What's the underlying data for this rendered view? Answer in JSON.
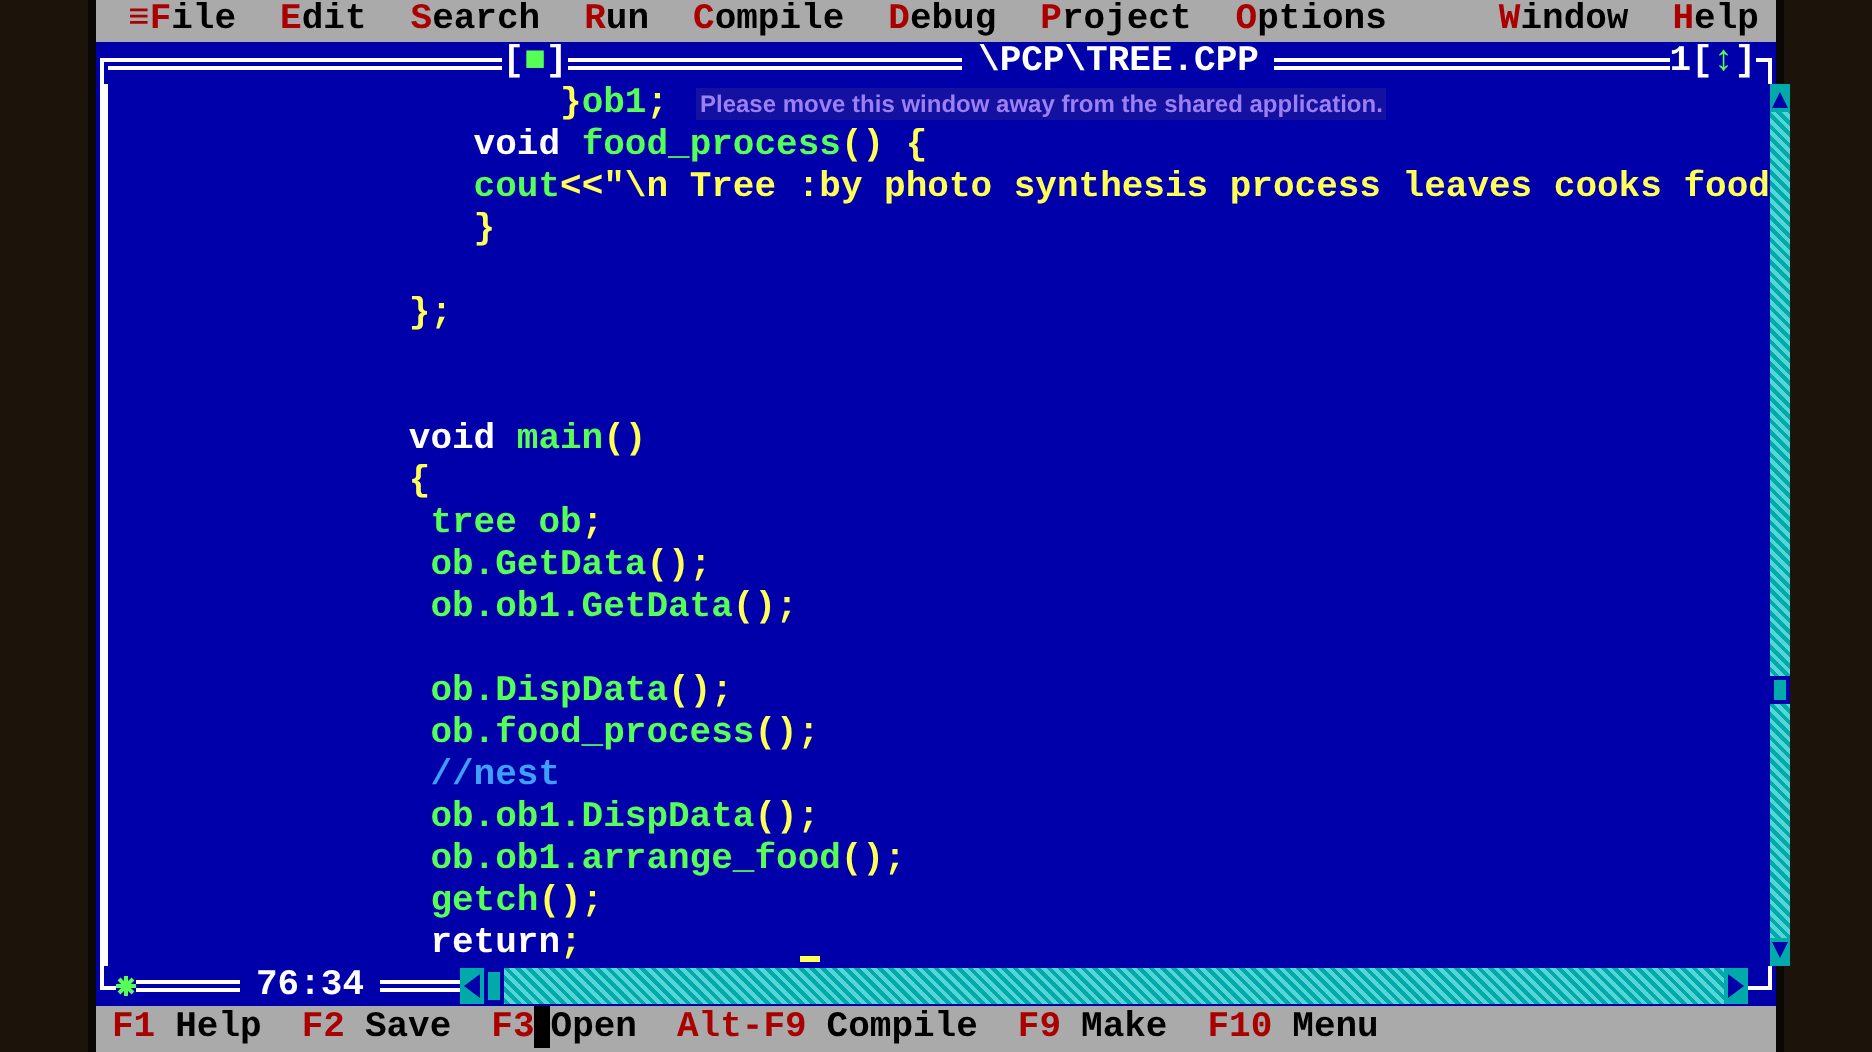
{
  "menu_bar": {
    "system_icon": "≡",
    "items": [
      {
        "label": "File"
      },
      {
        "label": "Edit"
      },
      {
        "label": "Search"
      },
      {
        "label": "Run"
      },
      {
        "label": "Compile"
      },
      {
        "label": "Debug"
      },
      {
        "label": "Project"
      },
      {
        "label": "Options"
      },
      {
        "label": "Window"
      },
      {
        "label": "Help"
      }
    ]
  },
  "editor": {
    "close_box": "[■]",
    "title": "\\PCP\\TREE.CPP",
    "window_number": "1",
    "zoom_box": "[↕]",
    "share_notice": "Please move this window away from the shared application.",
    "position": "76:34",
    "lines": [
      {
        "kind": "code",
        "tokens": [
          {
            "kind": "symbol",
            "text": "}"
          },
          {
            "kind": "ident",
            "text": "ob1"
          },
          {
            "kind": "symbol",
            "text": ";"
          }
        ]
      },
      {
        "kind": "code",
        "tokens": [
          {
            "kind": "keyword",
            "text": "void "
          },
          {
            "kind": "ident",
            "text": "food_process"
          },
          {
            "kind": "symbol",
            "text": "() {"
          }
        ]
      },
      {
        "kind": "code",
        "tokens": [
          {
            "kind": "ident",
            "text": "cout"
          },
          {
            "kind": "symbol",
            "text": "<<"
          },
          {
            "kind": "string",
            "text": "\"\\n Tree :by photo synthesis process leaves cooks food"
          }
        ]
      },
      {
        "kind": "code",
        "tokens": [
          {
            "kind": "symbol",
            "text": "}"
          }
        ]
      },
      {
        "kind": "blank"
      },
      {
        "kind": "code",
        "tokens": [
          {
            "kind": "symbol",
            "text": "};"
          }
        ]
      },
      {
        "kind": "blank"
      },
      {
        "kind": "blank"
      },
      {
        "kind": "code",
        "tokens": [
          {
            "kind": "keyword",
            "text": "void "
          },
          {
            "kind": "ident",
            "text": "main"
          },
          {
            "kind": "symbol",
            "text": "()"
          }
        ]
      },
      {
        "kind": "code",
        "tokens": [
          {
            "kind": "symbol",
            "text": "{"
          }
        ]
      },
      {
        "kind": "code",
        "tokens": [
          {
            "kind": "ident",
            "text": "tree ob"
          },
          {
            "kind": "symbol",
            "text": ";"
          }
        ]
      },
      {
        "kind": "code",
        "tokens": [
          {
            "kind": "ident",
            "text": "ob.GetData"
          },
          {
            "kind": "symbol",
            "text": "();"
          }
        ]
      },
      {
        "kind": "code",
        "tokens": [
          {
            "kind": "ident",
            "text": "ob.ob1.GetData"
          },
          {
            "kind": "symbol",
            "text": "();"
          }
        ]
      },
      {
        "kind": "blank"
      },
      {
        "kind": "code",
        "tokens": [
          {
            "kind": "ident",
            "text": "ob.DispData"
          },
          {
            "kind": "symbol",
            "text": "();"
          }
        ]
      },
      {
        "kind": "code",
        "tokens": [
          {
            "kind": "ident",
            "text": "ob.food_process"
          },
          {
            "kind": "symbol",
            "text": "();"
          }
        ]
      },
      {
        "kind": "code",
        "tokens": [
          {
            "kind": "comment",
            "text": "//nest"
          }
        ]
      },
      {
        "kind": "code",
        "tokens": [
          {
            "kind": "ident",
            "text": "ob.ob1.DispData"
          },
          {
            "kind": "symbol",
            "text": "();"
          }
        ]
      },
      {
        "kind": "code",
        "tokens": [
          {
            "kind": "ident",
            "text": "ob.ob1.arrange_food"
          },
          {
            "kind": "symbol",
            "text": "();"
          }
        ]
      },
      {
        "kind": "code",
        "tokens": [
          {
            "kind": "ident",
            "text": "getch"
          },
          {
            "kind": "symbol",
            "text": "();"
          }
        ]
      },
      {
        "kind": "code",
        "tokens": [
          {
            "kind": "keyword",
            "text": "return"
          },
          {
            "kind": "symbol",
            "text": ";"
          }
        ]
      }
    ]
  },
  "status_bar": [
    {
      "key": "F1",
      "label": "Help",
      "mouse_cursor": false
    },
    {
      "key": "F2",
      "label": "Save",
      "mouse_cursor": false
    },
    {
      "key": "F3",
      "label": "Open",
      "mouse_cursor": true
    },
    {
      "key": "Alt-F9",
      "label": "Compile",
      "mouse_cursor": false
    },
    {
      "key": "F9",
      "label": "Make",
      "mouse_cursor": false
    },
    {
      "key": "F10",
      "label": "Menu",
      "mouse_cursor": false
    }
  ]
}
